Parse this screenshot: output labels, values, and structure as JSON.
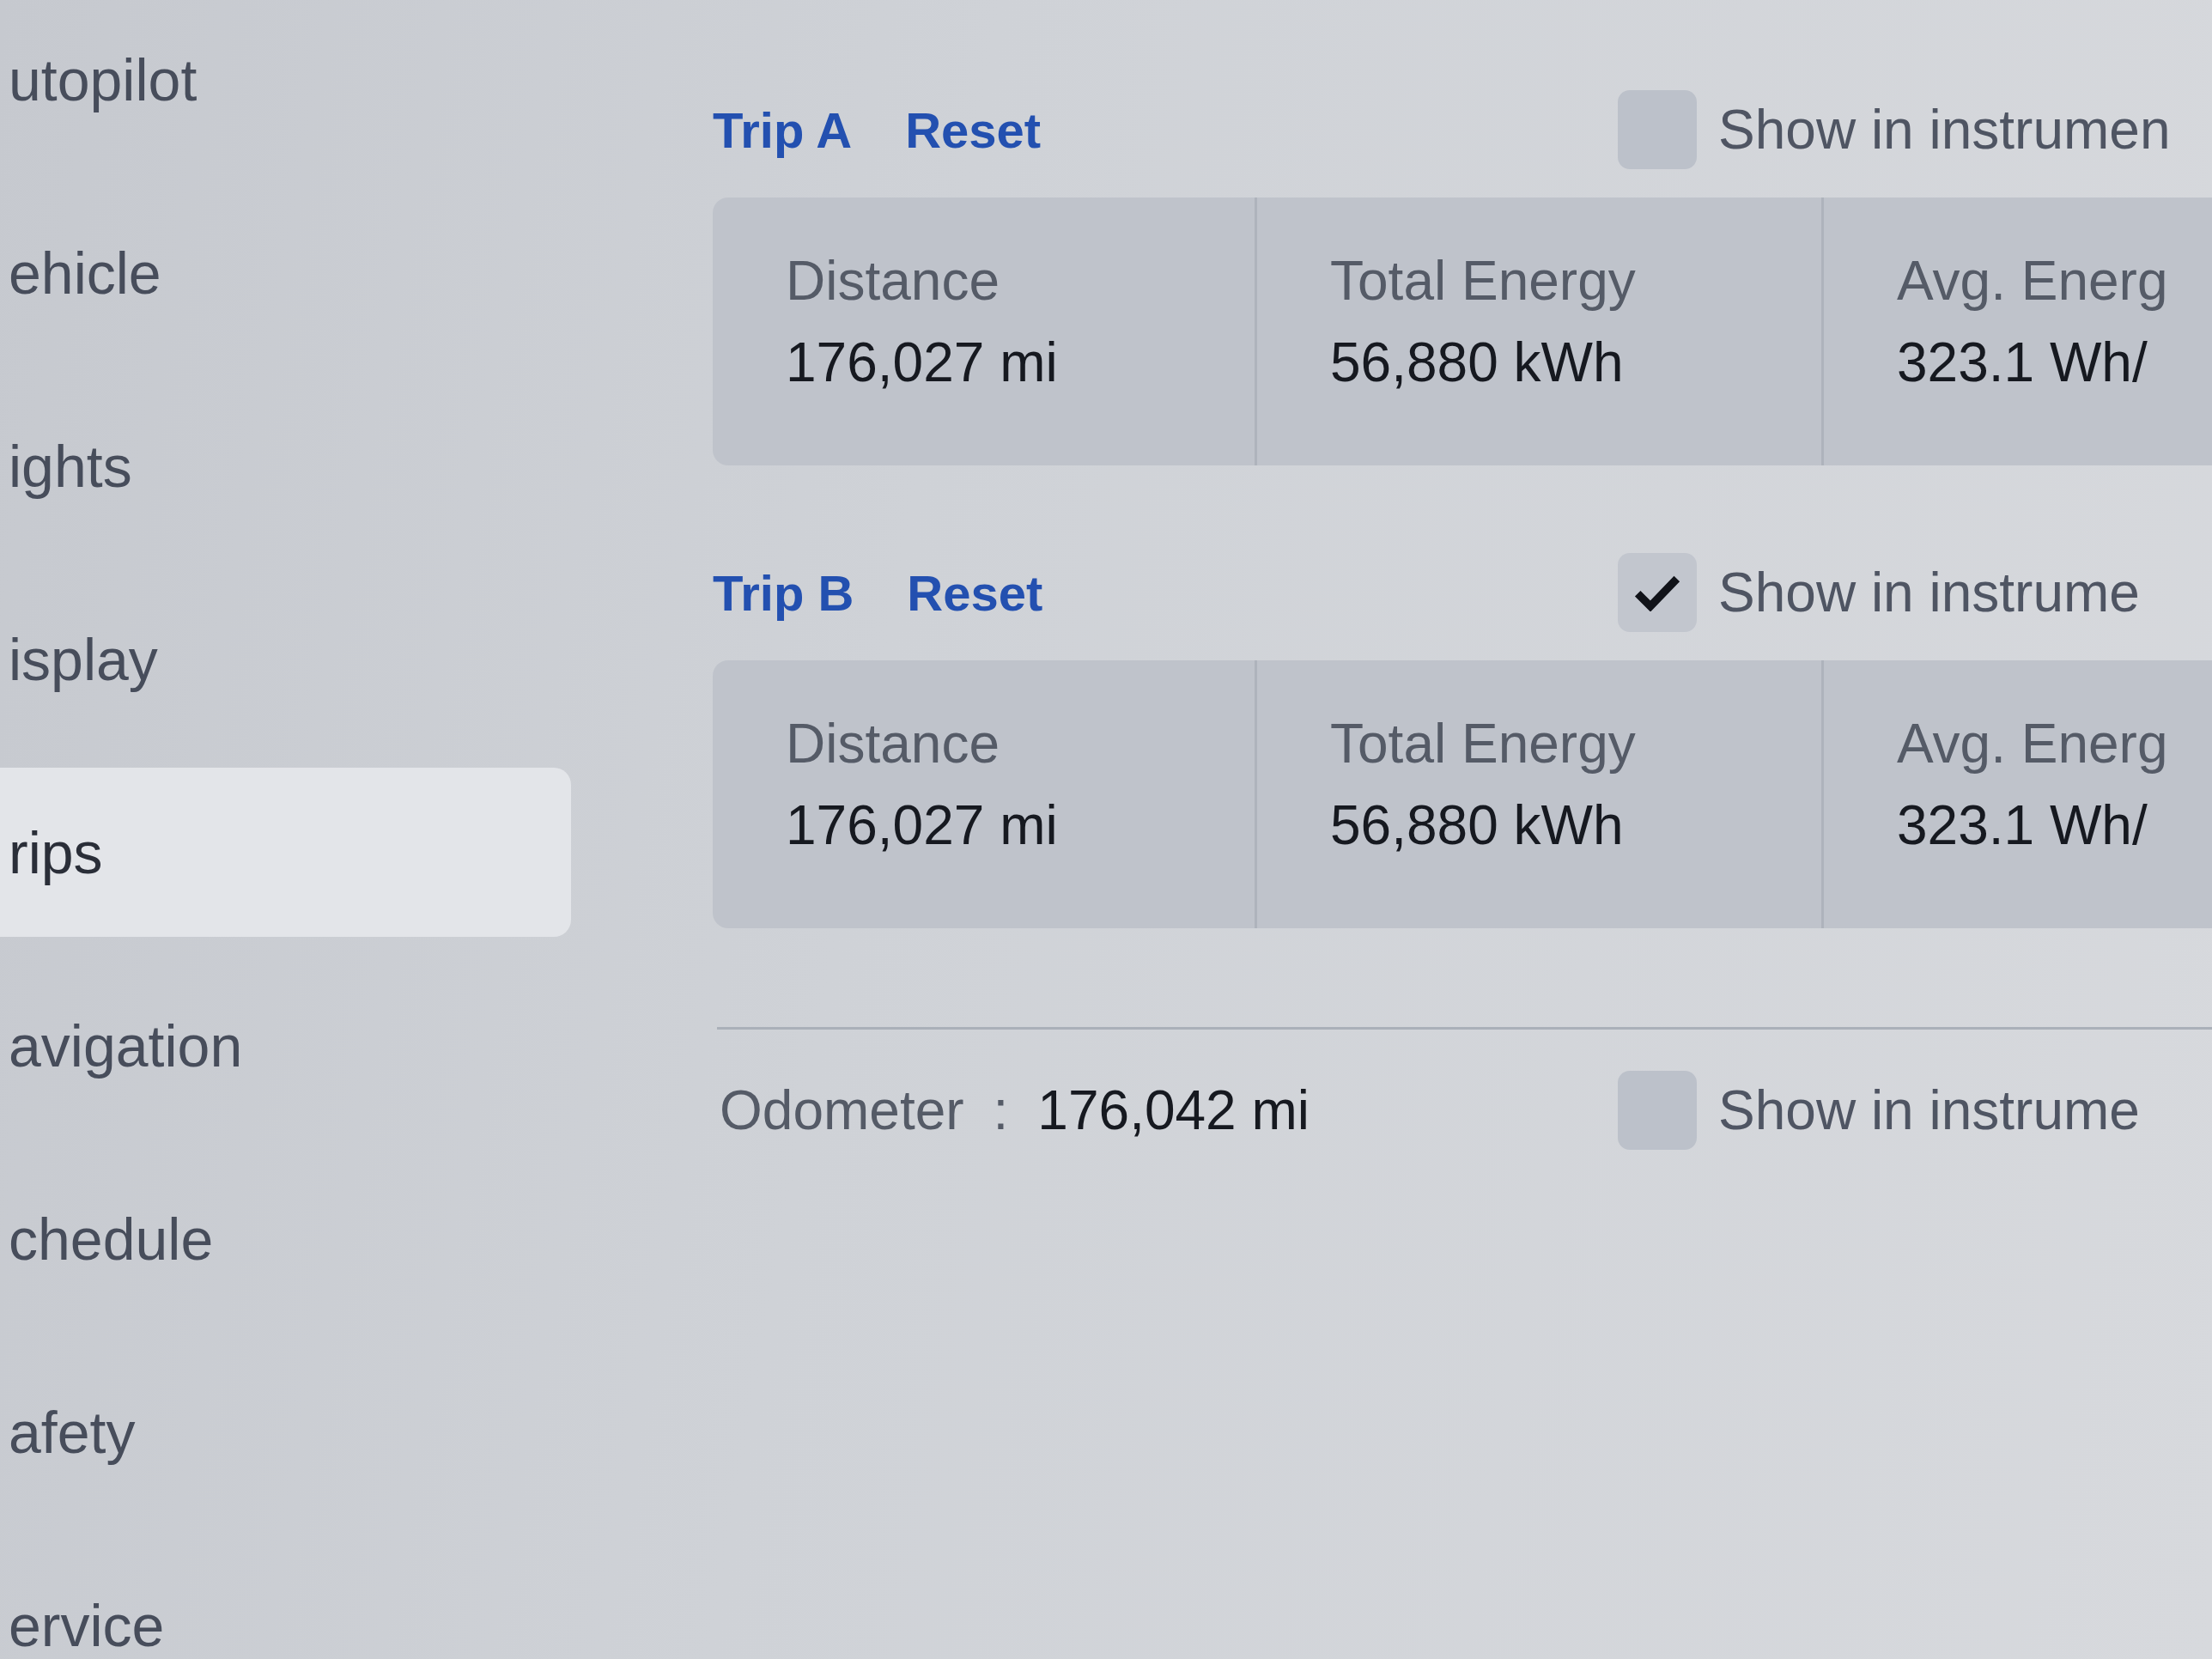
{
  "sidebar": {
    "items": [
      {
        "label": "utopilot",
        "selected": false
      },
      {
        "label": "ehicle",
        "selected": false
      },
      {
        "label": "ights",
        "selected": false
      },
      {
        "label": "isplay",
        "selected": false
      },
      {
        "label": "rips",
        "selected": true
      },
      {
        "label": "avigation",
        "selected": false
      },
      {
        "label": "chedule",
        "selected": false
      },
      {
        "label": "afety",
        "selected": false
      },
      {
        "label": "ervice",
        "selected": false
      }
    ]
  },
  "trips": [
    {
      "title": "Trip A",
      "reset": "Reset",
      "show_in_instrument": {
        "label": "Show in instrumen",
        "checked": false
      },
      "stats": [
        {
          "label": "Distance",
          "value": "176,027 mi"
        },
        {
          "label": "Total Energy",
          "value": "56,880 kWh"
        },
        {
          "label": "Avg. Energ",
          "value": "323.1 Wh/"
        }
      ]
    },
    {
      "title": "Trip B",
      "reset": "Reset",
      "show_in_instrument": {
        "label": "Show in instrume",
        "checked": true
      },
      "stats": [
        {
          "label": "Distance",
          "value": "176,027 mi"
        },
        {
          "label": "Total Energy",
          "value": "56,880 kWh"
        },
        {
          "label": "Avg. Energ",
          "value": "323.1 Wh/"
        }
      ]
    }
  ],
  "odometer": {
    "label": "Odometer",
    "separator": ":",
    "value": "176,042 mi",
    "show_in_instrument": {
      "label": "Show in instrume",
      "checked": false
    }
  }
}
